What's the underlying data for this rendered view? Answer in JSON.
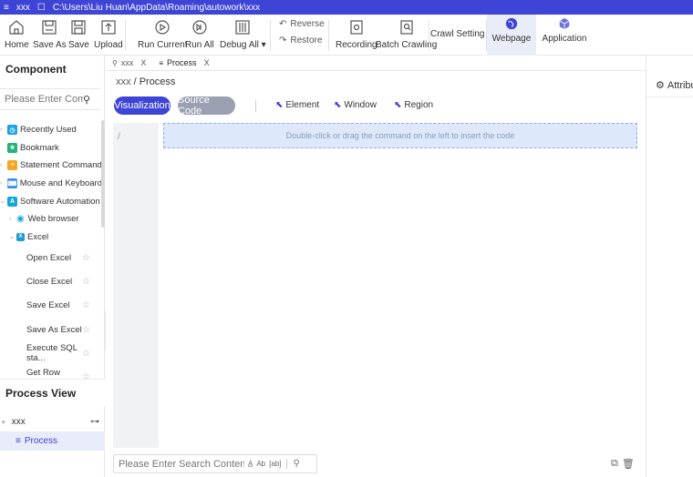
{
  "titlebar": {
    "menu": "≡",
    "project": "xxx",
    "path": "C:\\Users\\Liu Huan\\AppData\\Roaming\\autowork\\xxx"
  },
  "toolbar": {
    "home": "Home",
    "save_as": "Save As",
    "save": "Save",
    "upload": "Upload",
    "run_current": "Run Current",
    "run_all": "Run All",
    "debug_all": "Debug All",
    "reverse": "Reverse",
    "restore": "Restore",
    "recording": "Recording",
    "batch_crawling": "Batch Crawling",
    "crawl_setting": "Crawl Setting",
    "webpage": "Webpage",
    "application": "Application"
  },
  "component": {
    "title": "Component",
    "search_placeholder": "Please Enter Comp...",
    "categories": [
      {
        "label": "Recently Used",
        "color": "#1aa3e8",
        "glyph": "◷"
      },
      {
        "label": "Bookmark",
        "color": "#22b573",
        "glyph": "★"
      },
      {
        "label": "Statement Command",
        "color": "#f5a623",
        "glyph": "≡"
      },
      {
        "label": "Mouse and Keyboard",
        "color": "#3a8df0",
        "glyph": "⌨"
      },
      {
        "label": "Software Automation",
        "color": "#13a9d6",
        "glyph": "A"
      }
    ],
    "web_browser": "Web browser",
    "excel": "Excel",
    "excel_badge": "X",
    "items": [
      "Open Excel",
      "Close Excel",
      "Save Excel",
      "Save As Excel",
      "Execute SQL sta...",
      "Get Row Count"
    ]
  },
  "process_view": {
    "title": "Process View",
    "root": "xxx",
    "child": "Process"
  },
  "editor": {
    "tabs": [
      {
        "label": "xxx",
        "close": "X"
      },
      {
        "label": "Process",
        "close": "X"
      }
    ],
    "breadcrumb": {
      "root": "xxx",
      "sep": "/",
      "current": "Process"
    },
    "mode_visualization": "Visualization",
    "mode_source": "Source Code",
    "pick_element": "Element",
    "pick_window": "Window",
    "pick_region": "Region",
    "line_number": "/",
    "drop_hint": "Double-click or drag the command on the left to insert the code",
    "search_placeholder": "Please Enter Search Content",
    "search_opts": [
      "A̲",
      "Ab",
      "[ab]"
    ]
  },
  "attributes": {
    "title": "Attribute"
  },
  "colors": {
    "accent": "#3d44d6",
    "visualization_btn": "#3d44d6",
    "source_btn": "#9a9fb2"
  }
}
